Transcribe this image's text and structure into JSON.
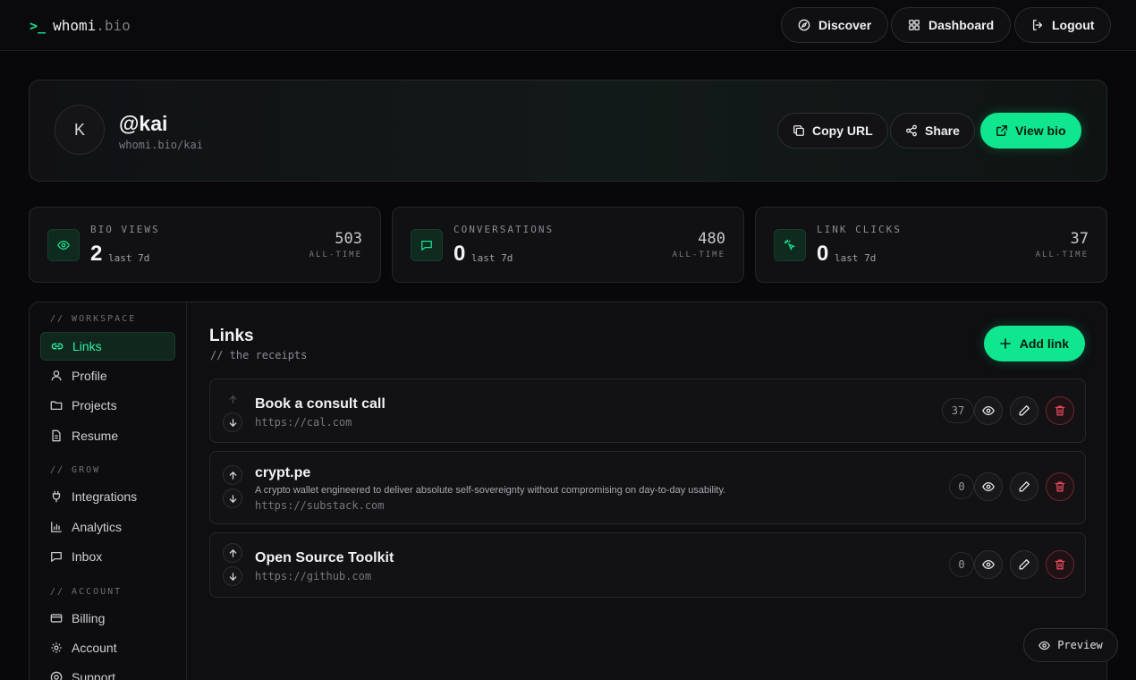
{
  "brand": {
    "prompt": ">_",
    "name": "whomi",
    "tld": ".bio"
  },
  "nav": {
    "discover": "Discover",
    "dashboard": "Dashboard",
    "logout": "Logout"
  },
  "profile": {
    "avatar_initial": "K",
    "handle": "@kai",
    "url": "whomi.bio/kai",
    "copy_url": "Copy URL",
    "share": "Share",
    "view_bio": "View bio"
  },
  "stats": [
    {
      "label": "BIO VIEWS",
      "value": "2",
      "period": "last 7d",
      "all_time": "503",
      "all_time_label": "ALL-TIME",
      "icon": "eye-icon"
    },
    {
      "label": "CONVERSATIONS",
      "value": "0",
      "period": "last 7d",
      "all_time": "480",
      "all_time_label": "ALL-TIME",
      "icon": "message-icon"
    },
    {
      "label": "LINK CLICKS",
      "value": "0",
      "period": "last 7d",
      "all_time": "37",
      "all_time_label": "ALL-TIME",
      "icon": "pointer-click-icon"
    }
  ],
  "sidebar": {
    "sections": [
      {
        "title": "// WORKSPACE",
        "items": [
          {
            "label": "Links",
            "icon": "link-icon",
            "active": true
          },
          {
            "label": "Profile",
            "icon": "user-icon"
          },
          {
            "label": "Projects",
            "icon": "folder-icon"
          },
          {
            "label": "Resume",
            "icon": "document-icon"
          }
        ]
      },
      {
        "title": "// GROW",
        "items": [
          {
            "label": "Integrations",
            "icon": "plug-icon"
          },
          {
            "label": "Analytics",
            "icon": "bar-chart-icon"
          },
          {
            "label": "Inbox",
            "icon": "message-icon"
          }
        ]
      },
      {
        "title": "// ACCOUNT",
        "items": [
          {
            "label": "Billing",
            "icon": "credit-card-icon"
          },
          {
            "label": "Account",
            "icon": "gear-icon"
          },
          {
            "label": "Support",
            "icon": "help-icon"
          }
        ]
      }
    ]
  },
  "links": {
    "title": "Links",
    "subtitle": "// the receipts",
    "add_label": "Add link",
    "items": [
      {
        "title": "Book a consult call",
        "description": "",
        "url": "https://cal.com",
        "clicks": "37"
      },
      {
        "title": "crypt.pe",
        "description": "A crypto wallet engineered to deliver absolute self-sovereignty without compromising on day-to-day usability.",
        "url": "https://substack.com",
        "clicks": "0"
      },
      {
        "title": "Open Source Toolkit",
        "description": "",
        "url": "https://github.com",
        "clicks": "0"
      }
    ]
  },
  "preview_label": "Preview",
  "colors": {
    "accent": "#10e68d",
    "danger": "#e0485a",
    "background": "#08080a"
  }
}
